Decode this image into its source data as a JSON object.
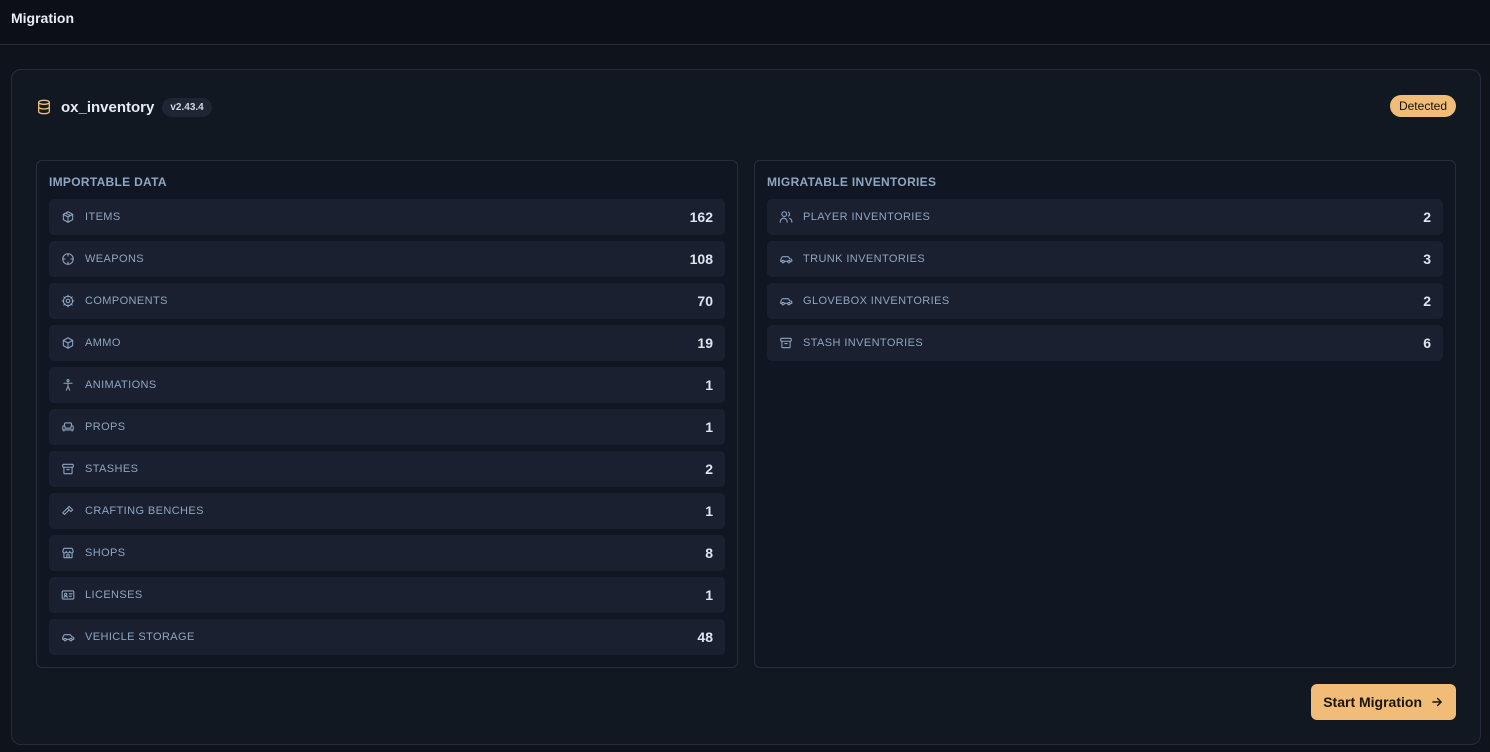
{
  "header": {
    "title": "Migration"
  },
  "source": {
    "name": "ox_inventory",
    "version": "v2.43.4",
    "status": "Detected",
    "icon": "database-icon"
  },
  "importable": {
    "title": "IMPORTABLE DATA",
    "items": [
      {
        "label": "ITEMS",
        "count": "162",
        "icon": "package-icon"
      },
      {
        "label": "WEAPONS",
        "count": "108",
        "icon": "crosshair-icon"
      },
      {
        "label": "COMPONENTS",
        "count": "70",
        "icon": "cog-icon"
      },
      {
        "label": "AMMO",
        "count": "19",
        "icon": "box-icon"
      },
      {
        "label": "ANIMATIONS",
        "count": "1",
        "icon": "person-icon"
      },
      {
        "label": "PROPS",
        "count": "1",
        "icon": "sofa-icon"
      },
      {
        "label": "STASHES",
        "count": "2",
        "icon": "archive-icon"
      },
      {
        "label": "CRAFTING BENCHES",
        "count": "1",
        "icon": "hammer-icon"
      },
      {
        "label": "SHOPS",
        "count": "8",
        "icon": "store-icon"
      },
      {
        "label": "LICENSES",
        "count": "1",
        "icon": "id-card-icon"
      },
      {
        "label": "VEHICLE STORAGE",
        "count": "48",
        "icon": "car-icon"
      }
    ]
  },
  "migratable": {
    "title": "MIGRATABLE INVENTORIES",
    "items": [
      {
        "label": "PLAYER INVENTORIES",
        "count": "2",
        "icon": "users-icon"
      },
      {
        "label": "TRUNK INVENTORIES",
        "count": "3",
        "icon": "car-icon"
      },
      {
        "label": "GLOVEBOX INVENTORIES",
        "count": "2",
        "icon": "car-icon"
      },
      {
        "label": "STASH INVENTORIES",
        "count": "6",
        "icon": "archive-icon"
      }
    ]
  },
  "actions": {
    "start_label": "Start Migration"
  },
  "colors": {
    "accent": "#f0bc78",
    "background": "#0f131b",
    "card": "#121822",
    "row": "#1a2030",
    "label": "#8ea5c1"
  }
}
